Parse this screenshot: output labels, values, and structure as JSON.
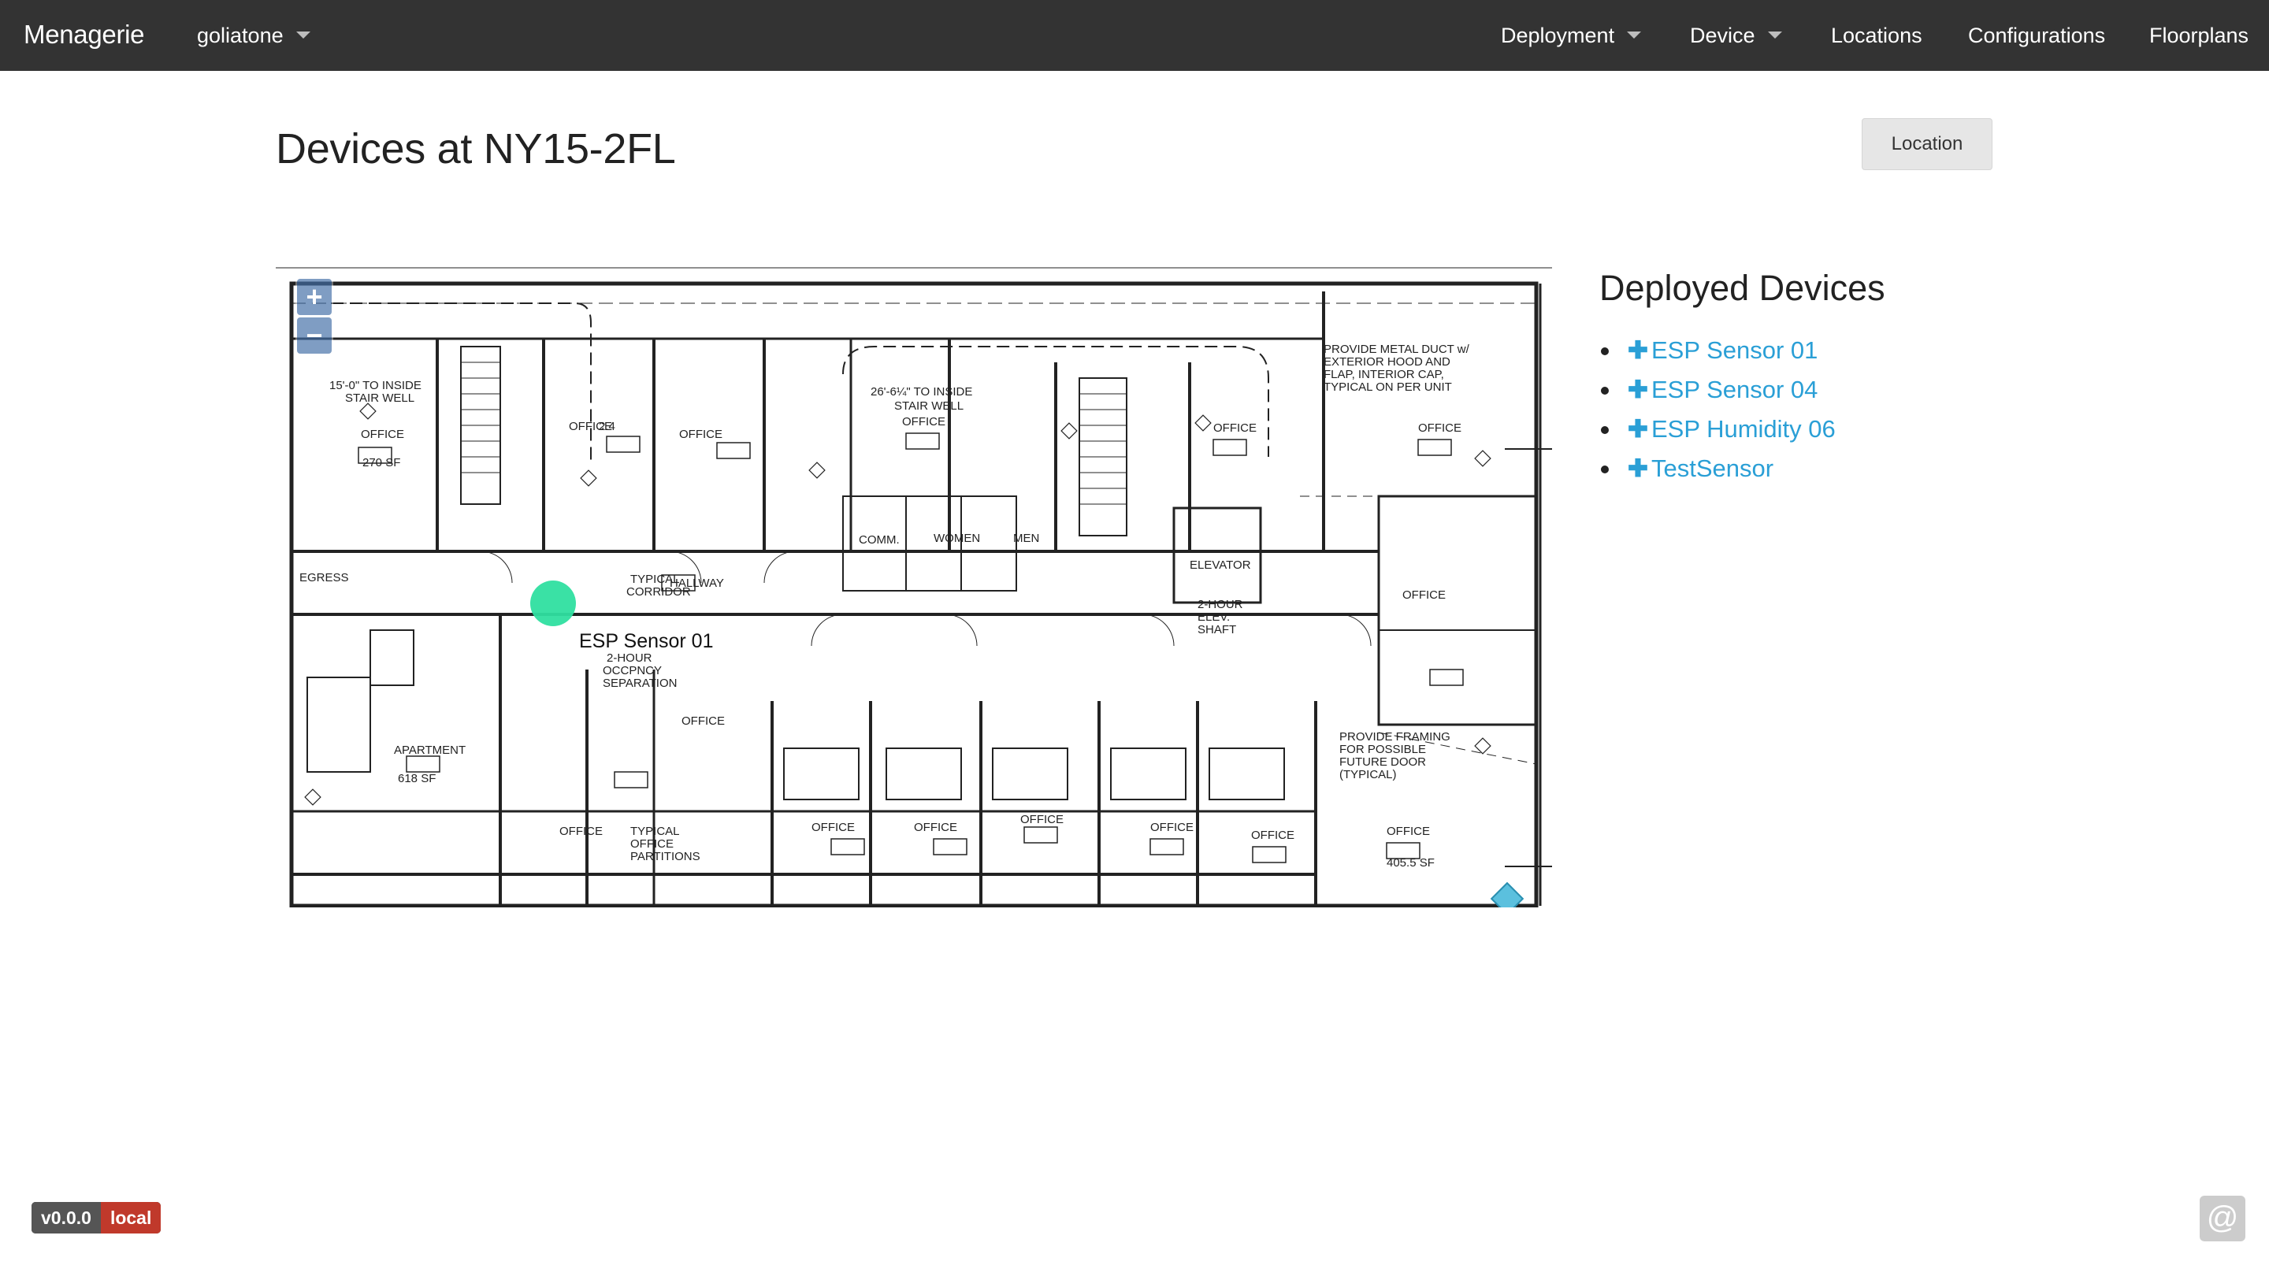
{
  "navbar": {
    "brand": "Menagerie",
    "org_selector": "goliatone",
    "menu": {
      "deployment": "Deployment",
      "device": "Device",
      "locations": "Locations",
      "configurations": "Configurations",
      "floorplans": "Floorplans"
    }
  },
  "page": {
    "title": "Devices at NY15-2FL",
    "location_button": "Location"
  },
  "map": {
    "zoom_in": "+",
    "zoom_out": "−",
    "marker_label": "ESP Sensor 01",
    "marker_color": "#2fdfa0"
  },
  "sidebar": {
    "title": "Deployed Devices",
    "devices": [
      {
        "label": "ESP Sensor 01"
      },
      {
        "label": "ESP Sensor 04"
      },
      {
        "label": "ESP Humidity 06"
      },
      {
        "label": "TestSensor"
      }
    ]
  },
  "footer": {
    "version": "v0.0.0",
    "environment": "local",
    "at_icon": "@"
  },
  "colors": {
    "navbar_bg": "#333333",
    "link": "#2a9fd6",
    "env_badge": "#c0392b"
  }
}
